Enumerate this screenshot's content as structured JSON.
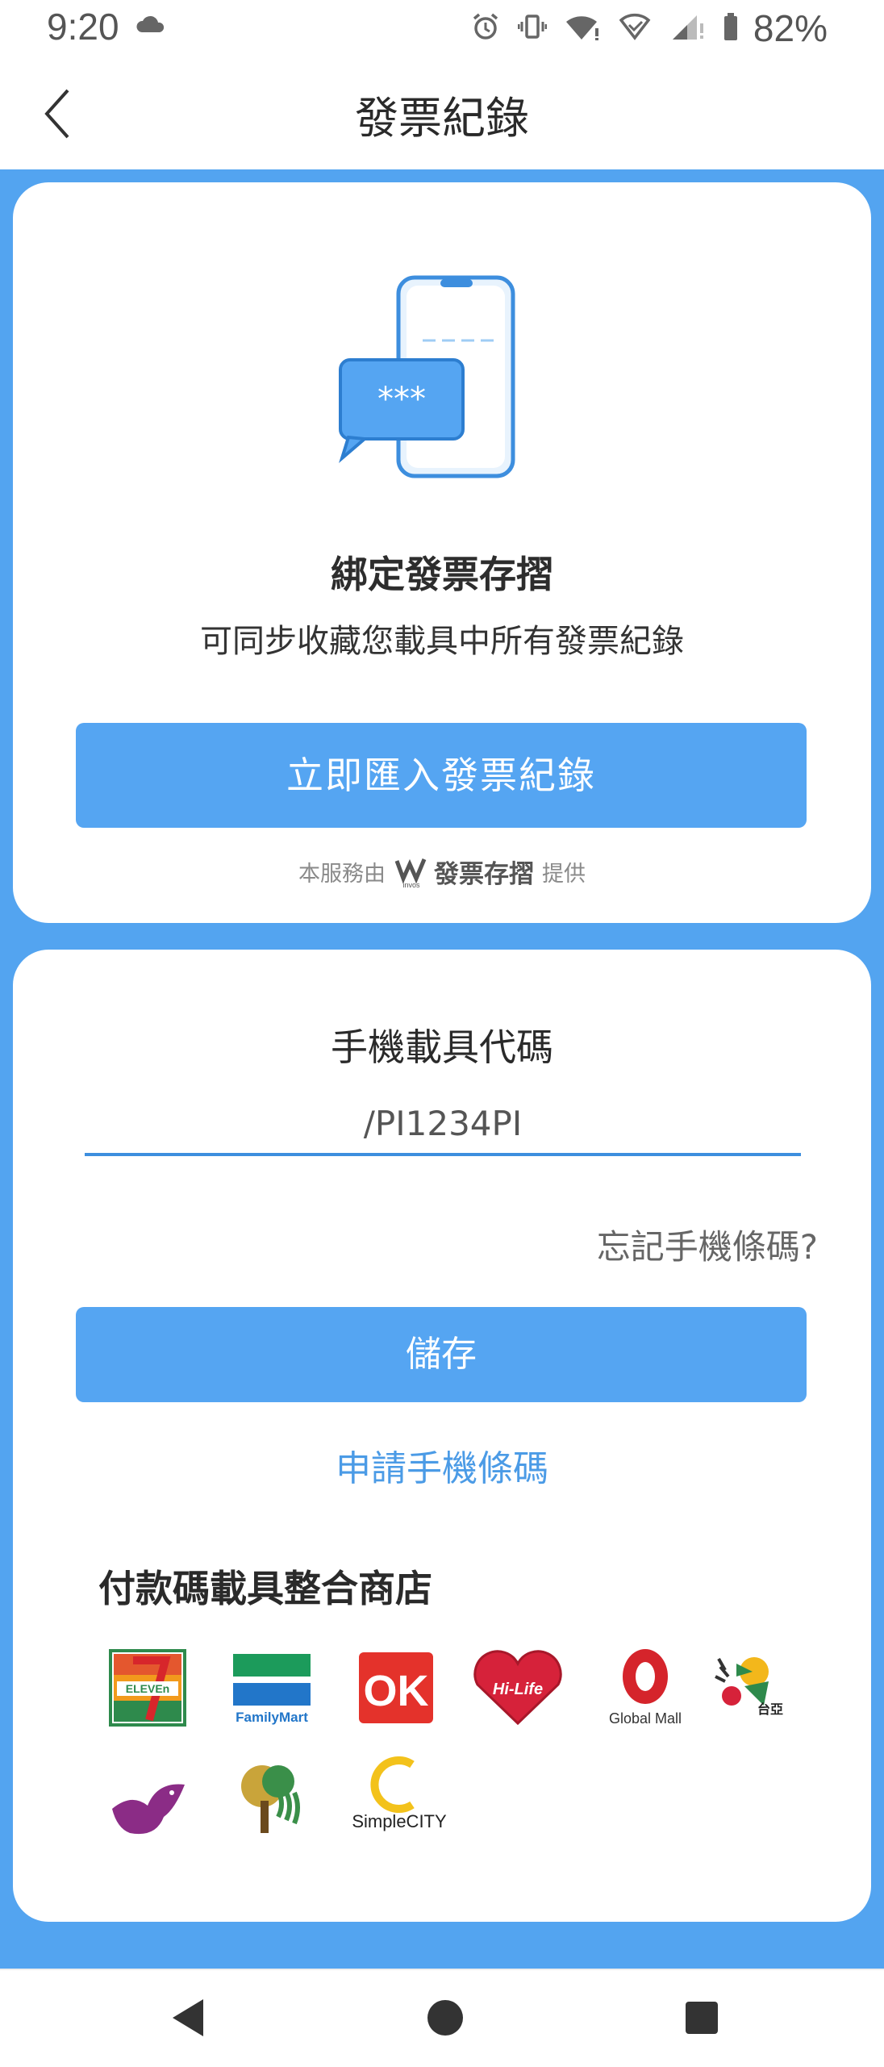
{
  "status_bar": {
    "time": "9:20",
    "battery": "82%",
    "icons": [
      "cloud-icon",
      "alarm-icon",
      "vibrate-icon",
      "wifi-icon",
      "wifi-calling-icon",
      "signal-icon",
      "battery-icon"
    ]
  },
  "header": {
    "title": "發票紀錄",
    "back_icon": "chevron-left-icon"
  },
  "bind_card": {
    "heading": "綁定發票存摺",
    "description": "可同步收藏您載具中所有發票紀錄",
    "import_button": "立即匯入發票紀錄",
    "provider_prefix": "本服務由",
    "provider_logo_small": "invos",
    "provider_brand": "發票存摺",
    "provider_suffix": "提供",
    "illustration_text": "***"
  },
  "carrier_card": {
    "title": "手機載具代碼",
    "input_value": "/PI1234PI",
    "forgot_link": "忘記手機條碼?",
    "save_button": "儲存",
    "apply_link": "申請手機條碼",
    "stores_title": "付款碼載具整合商店",
    "stores": [
      {
        "name": "7-Eleven",
        "logo_text": "ELEVEn"
      },
      {
        "name": "FamilyMart",
        "logo_text": "FamilyMart"
      },
      {
        "name": "OK",
        "logo_text": "OK"
      },
      {
        "name": "Hi-Life",
        "logo_text": "Hi-Life"
      },
      {
        "name": "Global Mall",
        "logo_text": "Global Mall"
      },
      {
        "name": "台亞加油站",
        "logo_text": "台亞"
      },
      {
        "name": "bird-store",
        "logo_text": ""
      },
      {
        "name": "tree-store",
        "logo_text": ""
      },
      {
        "name": "SimpleCITY",
        "logo_text": "SimpleCITY"
      }
    ]
  },
  "colors": {
    "background": "#53a4f0",
    "button": "#55a5f2",
    "link": "#4b9be6",
    "underline": "#3d8ede"
  }
}
